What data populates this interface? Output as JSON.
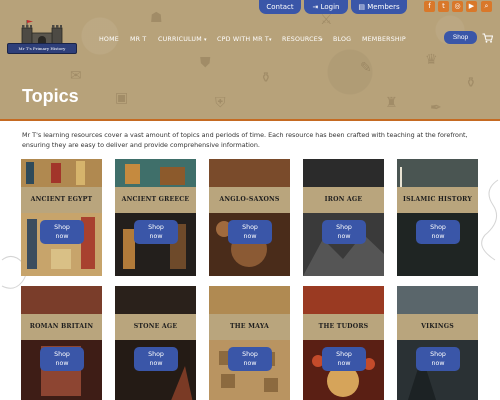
{
  "top_bar": {
    "contact": "Contact",
    "login": "Login",
    "members": "Members",
    "social_icons": [
      "facebook-icon",
      "twitter-icon",
      "instagram-icon",
      "youtube-icon",
      "search-icon"
    ],
    "social_glyphs": [
      "f",
      "t",
      "◎",
      "▶",
      "⌕"
    ]
  },
  "logo": {
    "text": "Mr T's Primary History"
  },
  "nav": {
    "items": [
      "HOME",
      "MR T",
      "CURRICULUM",
      "CPD WITH MR T",
      "RESOURCES",
      "BLOG",
      "MEMBERSHIP"
    ],
    "shop": "Shop"
  },
  "page": {
    "title": "Topics",
    "intro": "Mr T's learning resources cover a vast amount of topics and periods of time. Each resource has been crafted with teaching at the forefront, ensuring they are easy to deliver and provide comprehensive information."
  },
  "topics": [
    {
      "name": "ANCIENT EGYPT",
      "cta": "Shop now"
    },
    {
      "name": "ANCIENT GREECE",
      "cta": "Shop now"
    },
    {
      "name": "ANGLO-SAXONS",
      "cta": "Shop now"
    },
    {
      "name": "IRON AGE",
      "cta": "Shop now"
    },
    {
      "name": "ISLAMIC HISTORY",
      "cta": "Shop now"
    },
    {
      "name": "ROMAN BRITAIN",
      "cta": "Shop now"
    },
    {
      "name": "STONE AGE",
      "cta": "Shop now"
    },
    {
      "name": "THE MAYA",
      "cta": "Shop now"
    },
    {
      "name": "THE TUDORS",
      "cta": "Shop now"
    },
    {
      "name": "VIKINGS",
      "cta": "Shop now"
    }
  ],
  "colors": {
    "header_bg": "#b7a27a",
    "accent_blue": "#3a56a8",
    "accent_orange": "#d9782a",
    "band": "#b9a57d"
  }
}
